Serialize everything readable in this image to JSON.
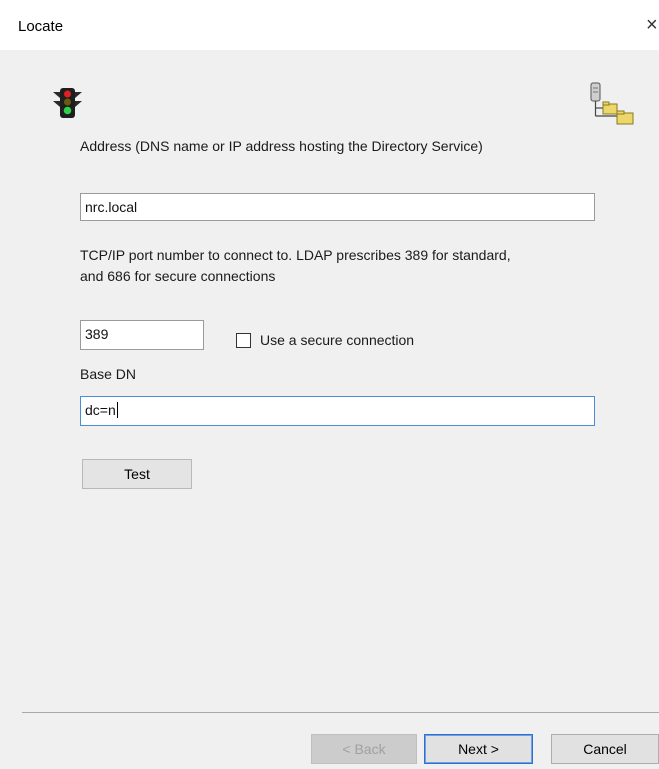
{
  "window": {
    "title": "Locate",
    "close_glyph": "×"
  },
  "icons": {
    "left": "traffic-light-icon",
    "right": "directory-tree-icon"
  },
  "address": {
    "label": "Address (DNS name or IP address hosting the Directory Service)",
    "value": "nrc.local"
  },
  "port": {
    "description_line1": "TCP/IP port number to connect to. LDAP prescribes 389 for standard,",
    "description_line2": "and 686 for secure connections",
    "value": "389"
  },
  "secure": {
    "label": "Use a secure connection",
    "checked": false
  },
  "base_dn": {
    "label": "Base DN",
    "value": "dc=n"
  },
  "buttons": {
    "test": "Test",
    "back": "< Back",
    "next": "Next >",
    "cancel": "Cancel"
  }
}
